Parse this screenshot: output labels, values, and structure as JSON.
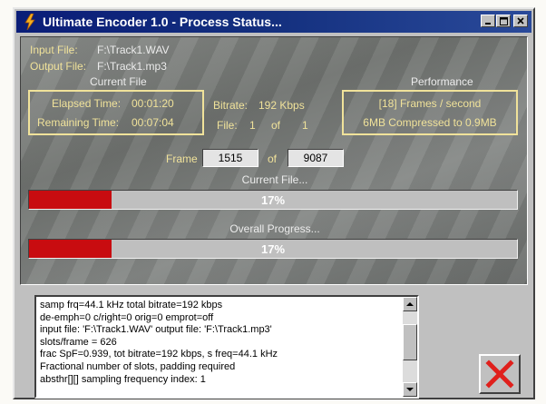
{
  "window": {
    "title": "Ultimate Encoder 1.0 - Process Status..."
  },
  "files": {
    "input_label": "Input File:",
    "input_value": "F:\\Track1.WAV",
    "output_label": "Output File:",
    "output_value": "F:\\Track1.mp3"
  },
  "current_file_section": {
    "heading": "Current File",
    "elapsed_label": "Elapsed Time:",
    "elapsed_value": "00:01:20",
    "remaining_label": "Remaining Time:",
    "remaining_value": "00:07:04"
  },
  "bitrate": {
    "label": "Bitrate:",
    "value": "192 Kbps"
  },
  "file_count": {
    "label": "File:",
    "current": "1",
    "of": "of",
    "total": "1"
  },
  "performance": {
    "heading": "Performance",
    "frames_per_second": "[18] Frames / second",
    "compression": "6MB Compressed to 0.9MB"
  },
  "frame": {
    "label": "Frame",
    "current": "1515",
    "of": "of",
    "total": "9087"
  },
  "progress": {
    "current_label": "Current File...",
    "current_percent": 17,
    "current_text": "17%",
    "overall_label": "Overall Progress...",
    "overall_percent": 17,
    "overall_text": "17%"
  },
  "log": {
    "lines": [
      "samp frq=44.1 kHz   total bitrate=192 kbps",
      "de-emph=0   c/right=0   orig=0   emprot=off",
      "input file: 'F:\\Track1.WAV'   output file: 'F:\\Track1.mp3'",
      "slots/frame = 626",
      "frac SpF=0.939, tot bitrate=192 kbps, s freq=44.1 kHz",
      "Fractional number of slots, padding required",
      "absthr[][] sampling frequency index: 1"
    ]
  },
  "colors": {
    "accent_yellow": "#f0e29a",
    "progress_red": "#c80c10",
    "title_blue": "#0a1d78",
    "close_red": "#e0201c"
  },
  "icons": [
    "app-lightning-icon",
    "minimize-icon",
    "maximize-icon",
    "window-close-icon",
    "scroll-up-icon",
    "scroll-down-icon",
    "red-x-icon"
  ]
}
